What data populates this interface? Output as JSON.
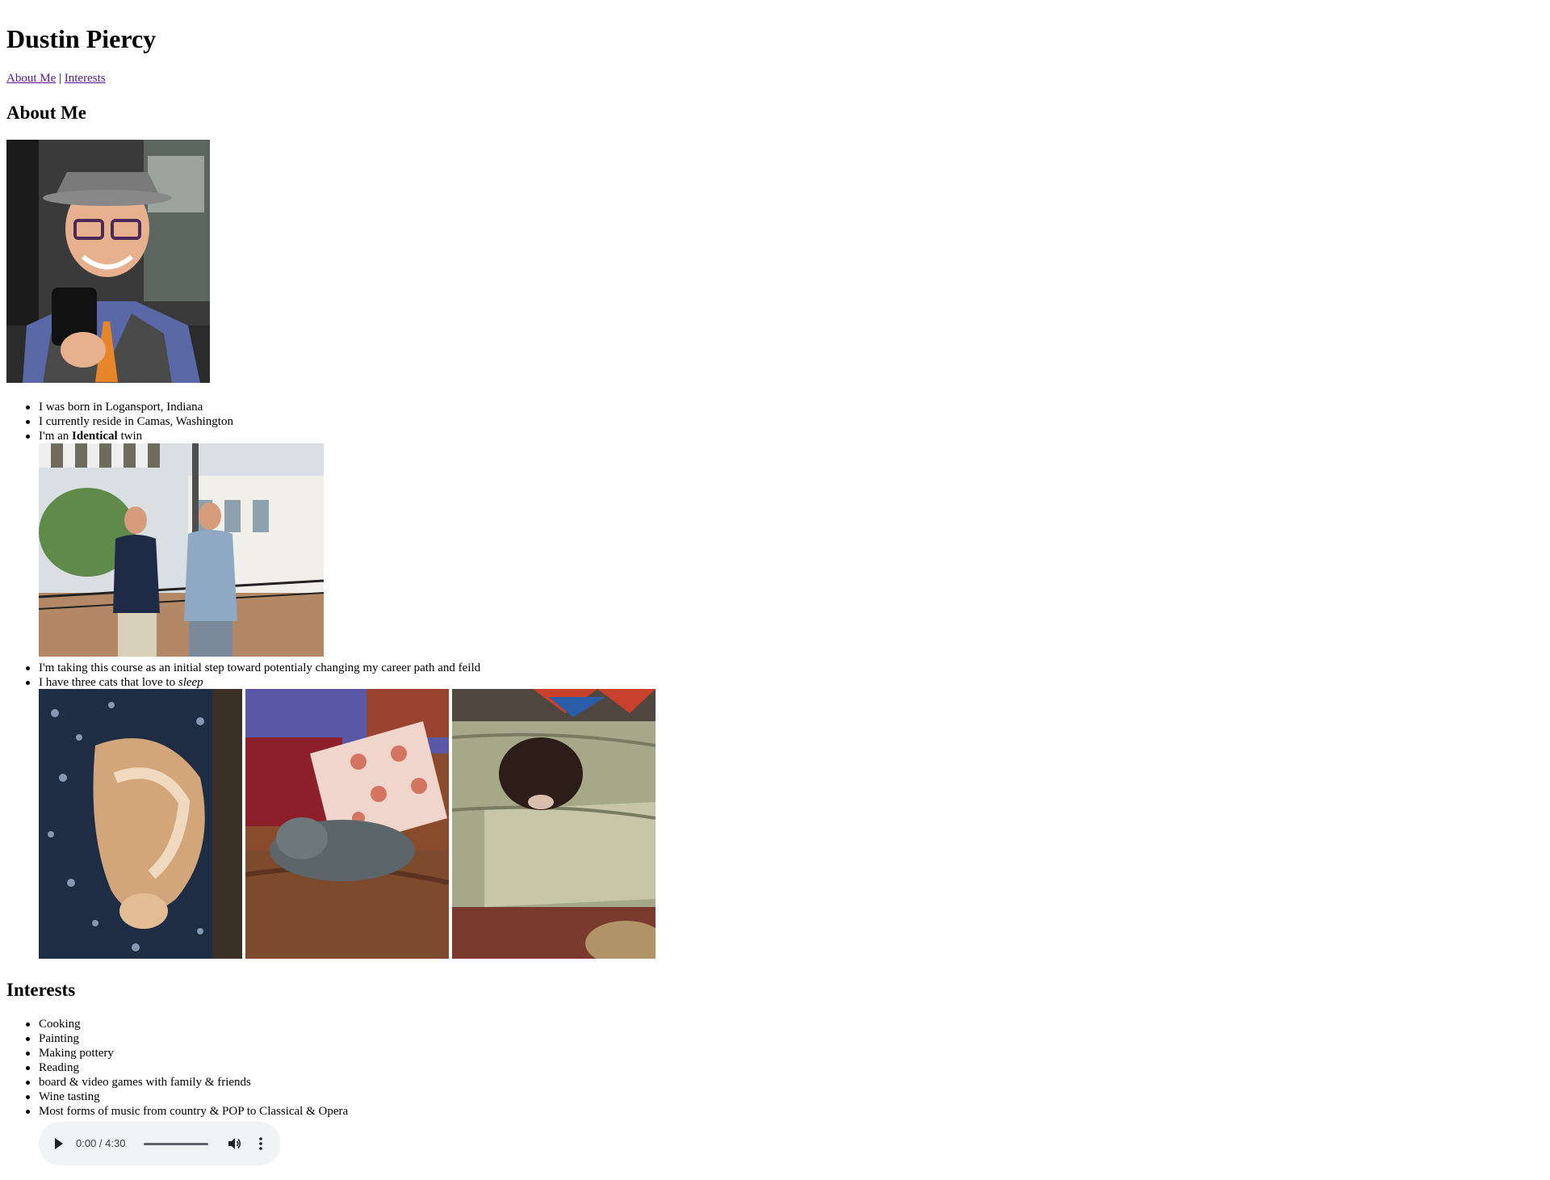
{
  "header": {
    "title": "Dustin Piercy"
  },
  "nav": {
    "about_link": "About Me",
    "separator": "|",
    "interests_link": "Interests"
  },
  "about": {
    "heading": "About Me",
    "facts": [
      "I was born in Logansport, Indiana",
      "I currently reside in Camas, Washington"
    ],
    "twin": {
      "before": "I'm an ",
      "bold": "Identical",
      "after": " twin"
    },
    "career": "I'm taking this course as an initial step toward potentialy changing my career path and feild",
    "cats": {
      "before": "I have three cats that love to ",
      "italic": "sleep"
    }
  },
  "interests": {
    "heading": "Interests",
    "items": [
      "Cooking",
      "Painting",
      "Making pottery",
      "Reading",
      "board & video games with family & friends",
      "Wine tasting",
      "Most forms of music from country & POP to Classical & Opera"
    ]
  },
  "audio_player": {
    "time": "0:00 / 4:30",
    "progress": 0
  },
  "icons": {
    "play": "play-icon",
    "volume": "volume-icon",
    "more": "more-options-icon"
  },
  "colors": {
    "visited_link": "#551a8b",
    "player_bg": "#f1f3f4"
  }
}
